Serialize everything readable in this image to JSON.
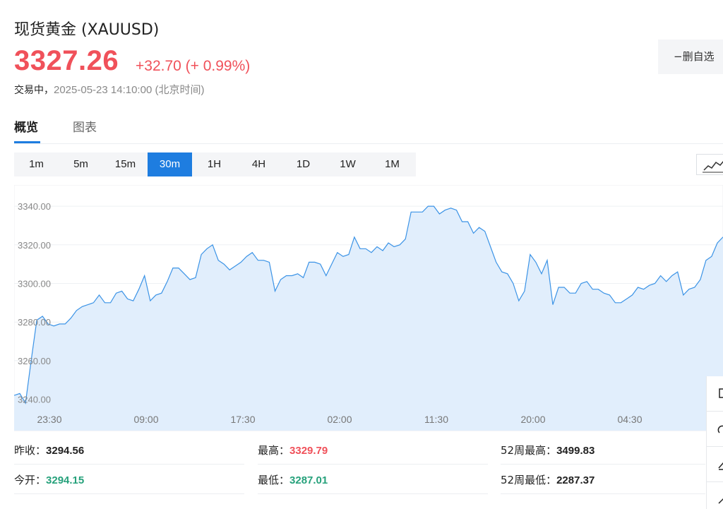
{
  "header": {
    "title": "现货黄金  (XAUUSD)",
    "price": "3327.26",
    "change": "+32.70 (+ 0.99%)",
    "status_label": "交易中，",
    "timestamp": "2025-05-23 14:10:00  (北京时间)",
    "watchlist_button": "删自选"
  },
  "tabs": [
    {
      "label": "概览",
      "active": true
    },
    {
      "label": "图表",
      "active": false
    }
  ],
  "periods": [
    {
      "label": "1m"
    },
    {
      "label": "5m"
    },
    {
      "label": "15m"
    },
    {
      "label": "30m",
      "active": true
    },
    {
      "label": "1H"
    },
    {
      "label": "4H"
    },
    {
      "label": "1D"
    },
    {
      "label": "1W"
    },
    {
      "label": "1M"
    }
  ],
  "chart_data": {
    "type": "area",
    "y_ticks": [
      "3340.00",
      "3320.00",
      "3300.00",
      "3280.00",
      "3260.00",
      "3240.00"
    ],
    "y_tick_values": [
      3340,
      3320,
      3300,
      3280,
      3260,
      3240
    ],
    "x_ticks": [
      "23:30",
      "09:00",
      "17:30",
      "02:00",
      "11:30",
      "20:00",
      "04:30"
    ],
    "ylim": [
      3234,
      3351
    ],
    "grid": true,
    "series": [
      {
        "values": [
          3242,
          3243,
          3238,
          3260,
          3281,
          3283,
          3279,
          3278,
          3279,
          3279,
          3282,
          3286,
          3288,
          3289,
          3290,
          3294,
          3290,
          3290,
          3295,
          3296,
          3292,
          3291,
          3297,
          3304,
          3291,
          3294,
          3295,
          3301,
          3308,
          3308,
          3305,
          3302,
          3303,
          3315,
          3318,
          3320,
          3312,
          3310,
          3307,
          3309,
          3311,
          3314,
          3316,
          3312,
          3312,
          3311,
          3296,
          3302,
          3304,
          3304,
          3305,
          3303,
          3311,
          3311,
          3310,
          3304,
          3310,
          3316,
          3314,
          3315,
          3324,
          3318,
          3318,
          3316,
          3319,
          3317,
          3321,
          3319,
          3320,
          3323,
          3337,
          3337,
          3337,
          3340,
          3340,
          3336,
          3338,
          3339,
          3338,
          3332,
          3332,
          3326,
          3329,
          3327,
          3319,
          3311,
          3306,
          3305,
          3300,
          3291,
          3296,
          3315,
          3311,
          3305,
          3312,
          3289,
          3298,
          3298,
          3295,
          3295,
          3300,
          3301,
          3297,
          3297,
          3295,
          3294,
          3290,
          3290,
          3292,
          3294,
          3298,
          3297,
          3299,
          3300,
          3304,
          3301,
          3304,
          3306,
          3294,
          3297,
          3298,
          3302,
          3312,
          3314,
          3321,
          3324
        ]
      }
    ]
  },
  "stats": [
    {
      "label": "昨收：",
      "value": "3294.56",
      "tone": "neutral"
    },
    {
      "label": "最高：",
      "value": "3329.79",
      "tone": "up"
    },
    {
      "label": "52周最高：",
      "value": "3499.83",
      "tone": "neutral"
    },
    {
      "label": "今开：",
      "value": "3294.15",
      "tone": "down"
    },
    {
      "label": "最低：",
      "value": "3287.01",
      "tone": "down"
    },
    {
      "label": "52周最低：",
      "value": "2287.37",
      "tone": "neutral"
    }
  ],
  "colors": {
    "accent": "#1e7de0",
    "up": "#f0515a",
    "down": "#26a17b",
    "line": "#3b93e6",
    "area_fill": "#e1eefc"
  },
  "icons": [
    "line-chart-icon",
    "side-tool-icon"
  ]
}
